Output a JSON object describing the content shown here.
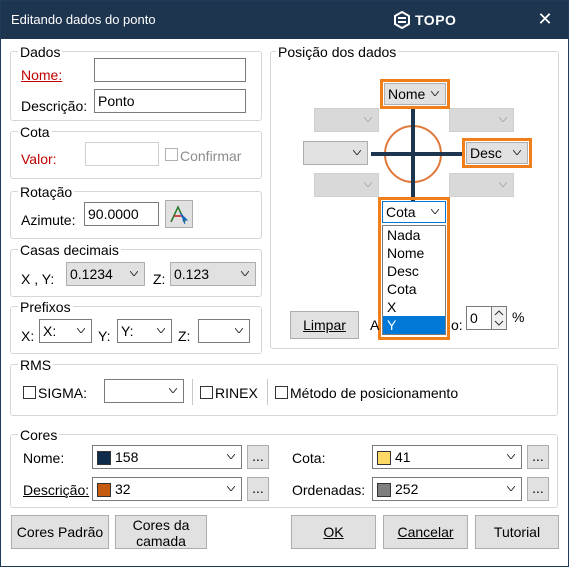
{
  "window": {
    "title": "Editando dados do ponto",
    "logo_text": "TOPO"
  },
  "dados": {
    "legend": "Dados",
    "nome_label": "Nome:",
    "nome_value": "",
    "descricao_label": "Descrição:",
    "descricao_value": "Ponto"
  },
  "cota": {
    "legend": "Cota",
    "valor_label": "Valor:",
    "valor_value": "",
    "confirmar_label": "Confirmar"
  },
  "rotacao": {
    "legend": "Rotação",
    "azimute_label": "Azimute:",
    "azimute_value": "90.0000"
  },
  "casas": {
    "legend": "Casas decimais",
    "xy_label": "X , Y:",
    "xy_value": "0.1234",
    "z_label": "Z:",
    "z_value": "0.123"
  },
  "prefixos": {
    "legend": "Prefixos",
    "x_label": "X:",
    "x_value": "X:",
    "y_label": "Y:",
    "y_value": "Y:",
    "z_label": "Z:",
    "z_value": ""
  },
  "posicao": {
    "legend": "Posição dos dados",
    "top_value": "Nome",
    "right_value": "Desc",
    "bottom_value": "Cota",
    "dropdown_options": [
      "Nada",
      "Nome",
      "Desc",
      "Cota",
      "X",
      "Y"
    ],
    "dropdown_selected": "Y",
    "limpar_label": "Limpar",
    "hidden_label_start": "A",
    "hidden_label_end": "o:",
    "percent_value": "0",
    "percent_unit": "%"
  },
  "rms": {
    "legend": "RMS",
    "sigma_label": "SIGMA:",
    "sigma_value": "",
    "rinex_label": "RINEX",
    "metodo_label": "Método de posicionamento"
  },
  "cores": {
    "legend": "Cores",
    "nome_label": "Nome:",
    "nome_value": "158",
    "nome_color": "#0f2a4a",
    "descricao_label": "Descrição:",
    "descricao_value": "32",
    "descricao_color": "#c55a11",
    "cota_label": "Cota:",
    "cota_value": "41",
    "cota_color": "#ffd966",
    "ordenadas_label": "Ordenadas:",
    "ordenadas_value": "252",
    "ordenadas_color": "#7f7f7f",
    "dots_label": "..."
  },
  "buttons": {
    "cores_padrao": "Cores Padrão",
    "cores_camada_1": "Cores da",
    "cores_camada_2": "camada",
    "ok": "OK",
    "cancelar": "Cancelar",
    "tutorial": "Tutorial"
  },
  "colors": {
    "title_bar": "#1e3550",
    "highlight": "#f07f1a",
    "cross": "#1e3550",
    "circle": "#e0783a",
    "selection": "#0078d7"
  }
}
